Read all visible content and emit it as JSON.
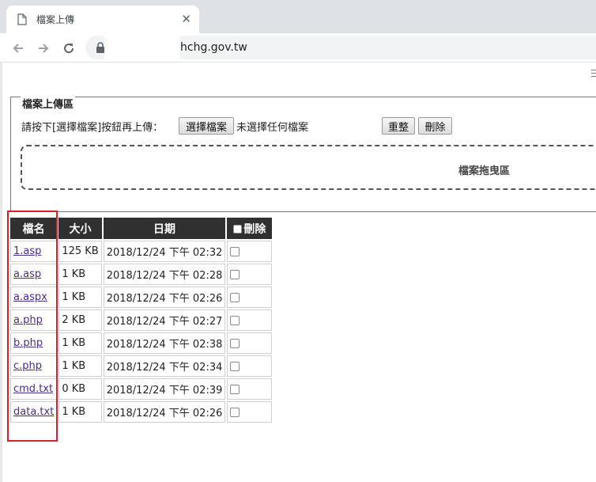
{
  "browser": {
    "tab_title": "檔案上傳",
    "tab_close": "✕",
    "url": "hchg.gov.tw"
  },
  "upload": {
    "legend": "檔案上傳區",
    "instruction": "請按下[選擇檔案]按鈕再上傳：",
    "choose_button": "選擇檔案",
    "no_file_text": "未選擇任何檔案",
    "reset_button": "重整",
    "delete_button": "刪除",
    "dropzone_label": "檔案拖曳區"
  },
  "table": {
    "headers": {
      "name": "檔名",
      "size": "大小",
      "date": "日期",
      "delete": "刪除"
    },
    "rows": [
      {
        "name": "1.asp",
        "size": "125 KB",
        "date": "2018/12/24 下午 02:32"
      },
      {
        "name": "a.asp",
        "size": "1 KB",
        "date": "2018/12/24 下午 02:28"
      },
      {
        "name": "a.aspx",
        "size": "1 KB",
        "date": "2018/12/24 下午 02:26"
      },
      {
        "name": "a.php",
        "size": "2 KB",
        "date": "2018/12/24 下午 02:27"
      },
      {
        "name": "b.php",
        "size": "1 KB",
        "date": "2018/12/24 下午 02:38"
      },
      {
        "name": "c.php",
        "size": "1 KB",
        "date": "2018/12/24 下午 02:34"
      },
      {
        "name": "cmd.txt",
        "size": "0 KB",
        "date": "2018/12/24 下午 02:39"
      },
      {
        "name": "data.txt",
        "size": "1 KB",
        "date": "2018/12/24 下午 02:26"
      }
    ]
  },
  "colors": {
    "table_header_bg": "#303030",
    "link": "#4a2a8a",
    "highlight_box": "#d3232a",
    "tabstrip": "#dee1e6"
  },
  "icons": [
    "document-icon",
    "close-icon",
    "back-arrow-icon",
    "forward-arrow-icon",
    "reload-icon",
    "lock-icon",
    "checkbox-icon"
  ]
}
